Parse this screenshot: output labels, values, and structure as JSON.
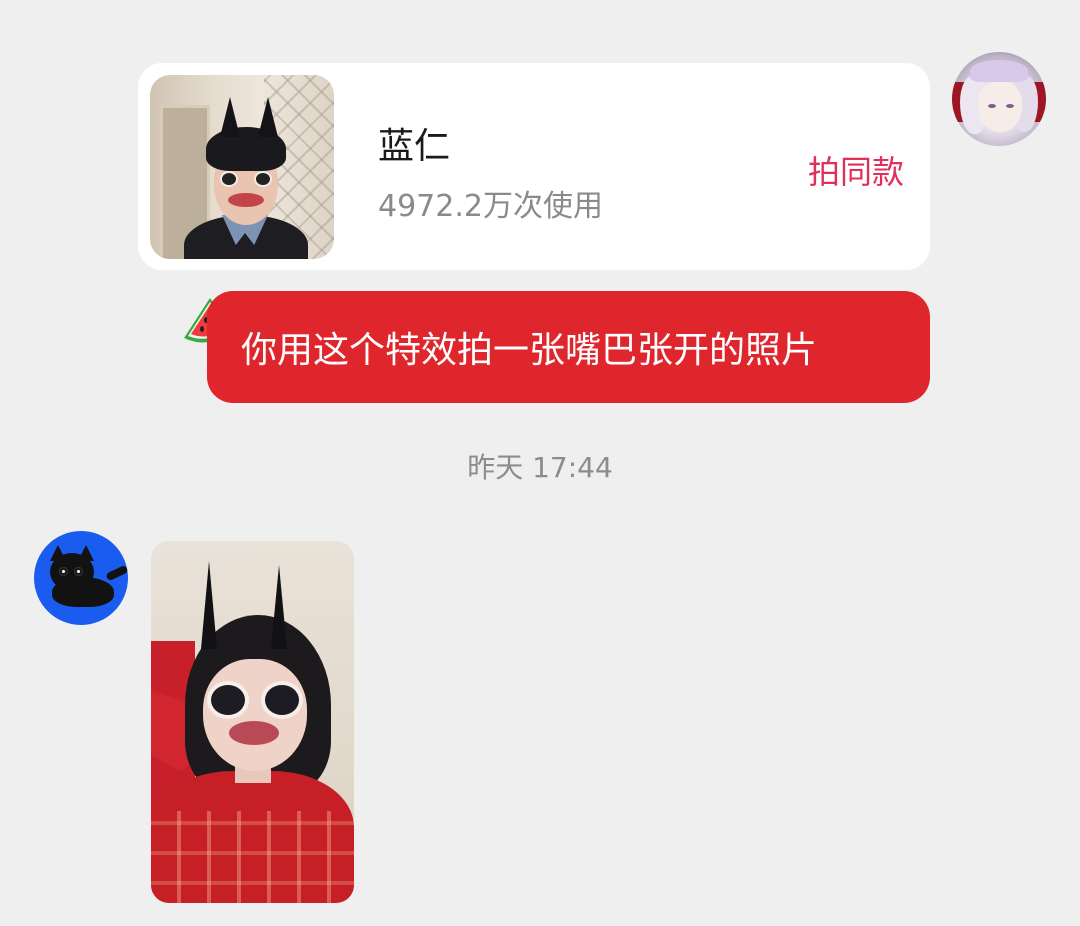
{
  "effect_card": {
    "name": "蓝仁",
    "usage": "4972.2万次使用",
    "cta": "拍同款"
  },
  "message": {
    "text": "你用这个特效拍一张嘴巴张开的照片"
  },
  "timestamp": "昨天 17:44",
  "colors": {
    "background": "#efefef",
    "card": "#ffffff",
    "bubble": "#e0262d",
    "cta": "#e0305a",
    "muted_text": "#8a8a8a"
  }
}
